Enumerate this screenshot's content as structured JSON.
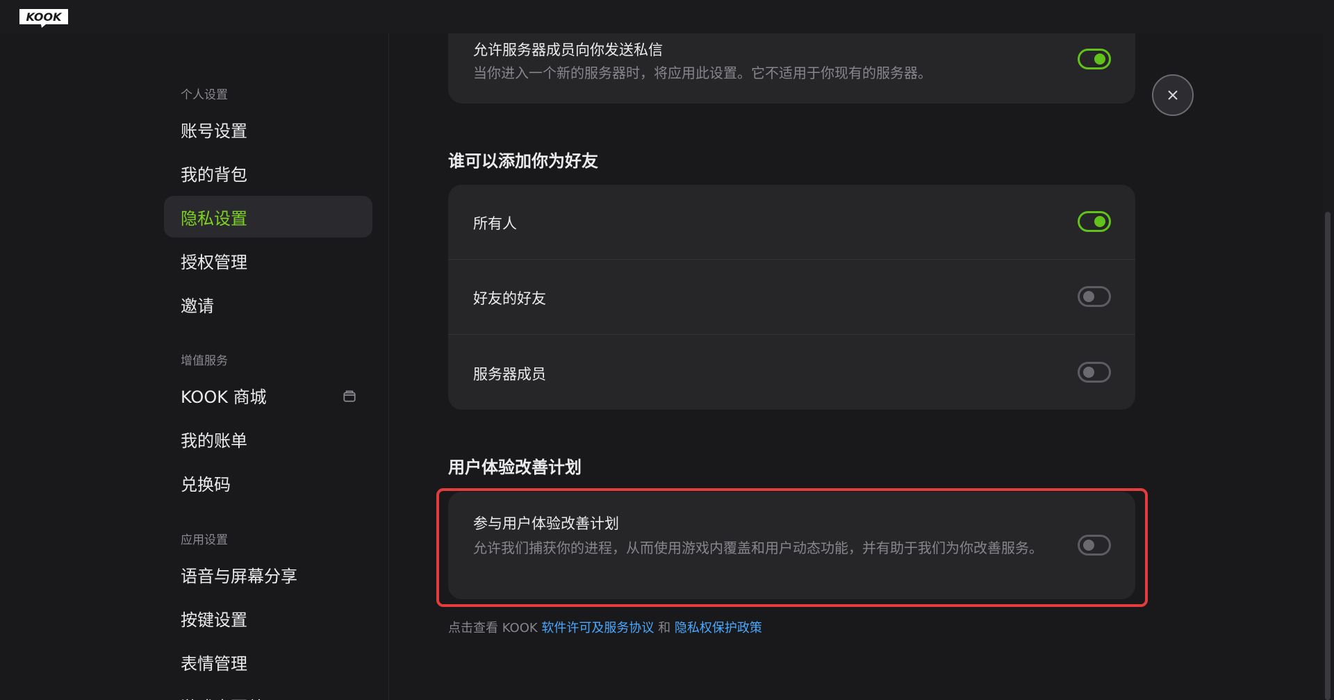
{
  "app": {
    "logo_text": "KOOK"
  },
  "titlebar": {
    "icons": [
      "store-icon",
      "shirt-icon",
      "help-icon",
      "minimize-icon",
      "restore-icon",
      "close-icon"
    ]
  },
  "sidebar": {
    "sections": [
      {
        "label": "个人设置"
      },
      {
        "label": "增值服务"
      },
      {
        "label": "应用设置"
      }
    ],
    "items": [
      {
        "label": "账号设置"
      },
      {
        "label": "我的背包"
      },
      {
        "label": "隐私设置",
        "active": true
      },
      {
        "label": "授权管理"
      },
      {
        "label": "邀请"
      },
      {
        "label": "KOOK 商城",
        "icon": "store-icon"
      },
      {
        "label": "我的账单"
      },
      {
        "label": "兑换码"
      },
      {
        "label": "语音与屏幕分享"
      },
      {
        "label": "按键设置"
      },
      {
        "label": "表情管理"
      },
      {
        "label": "游戏内覆盖"
      }
    ]
  },
  "main": {
    "dm_card": {
      "title": "允许服务器成员向你发送私信",
      "desc": "当你进入一个新的服务器时，将应用此设置。它不适用于你现有的服务器。",
      "enabled": true
    },
    "friends_section": {
      "title": "谁可以添加你为好友",
      "rows": [
        {
          "label": "所有人",
          "enabled": true
        },
        {
          "label": "好友的好友",
          "enabled": false
        },
        {
          "label": "服务器成员",
          "enabled": false
        }
      ]
    },
    "ux_section": {
      "title": "用户体验改善计划",
      "row": {
        "title": "参与用户体验改善计划",
        "desc": "允许我们捕获你的进程，从而使用游戏内覆盖和用户动态功能，并有助于我们为你改善服务。",
        "enabled": false
      }
    },
    "footer": {
      "prefix": "点击查看 KOOK ",
      "link1": "软件许可及服务协议",
      "middle": " 和 ",
      "link2": "隐私权保护政策"
    }
  },
  "colors": {
    "accent": "#62c21c",
    "active_text": "#7ed321",
    "link": "#4aa8ff",
    "highlight": "#e23c3c",
    "background": "#19191b",
    "card": "#262629"
  }
}
